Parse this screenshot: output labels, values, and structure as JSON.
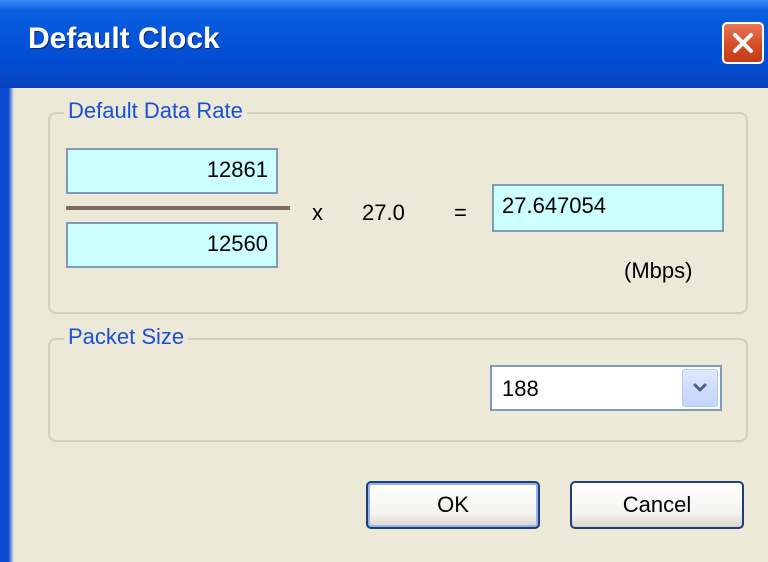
{
  "window": {
    "title": "Default Clock"
  },
  "data_rate": {
    "legend": "Default Data Rate",
    "numerator": "12861",
    "denominator": "12560",
    "multiply_sign": "x",
    "multiplier": "27.0",
    "equals_sign": "=",
    "result": "27.647054",
    "unit": "(Mbps)"
  },
  "packet_size": {
    "legend": "Packet Size",
    "selected": "188"
  },
  "buttons": {
    "ok": "OK",
    "cancel": "Cancel"
  },
  "colors": {
    "field_bg": "#ccffff",
    "legend_text": "#1a4fd6",
    "title_bar": "#0352d8",
    "close_button": "#d9502a",
    "dialog_bg": "#ece9d8"
  },
  "icons": {
    "close": "close-x-icon",
    "dropdown": "chevron-down-icon"
  }
}
